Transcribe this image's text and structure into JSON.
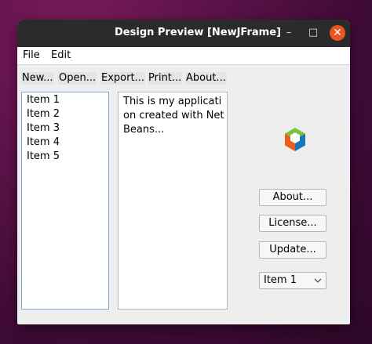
{
  "window": {
    "title": "Design Preview [NewJFrame]",
    "controls": {
      "minimize": "–",
      "maximize": "□",
      "close": "✕"
    }
  },
  "menubar": {
    "items": [
      "File",
      "Edit"
    ]
  },
  "toolbar": {
    "buttons": [
      "New...",
      "Open...",
      "Export...",
      "Print...",
      "About..."
    ]
  },
  "list": {
    "items": [
      "Item 1",
      "Item 2",
      "Item 3",
      "Item 4",
      "Item 5"
    ]
  },
  "textarea": {
    "text": "This is my application created with NetBeans..."
  },
  "logo": {
    "icon": "netbeans-logo-icon"
  },
  "side_buttons": {
    "about": "About...",
    "license": "License...",
    "update": "Update..."
  },
  "combo": {
    "selected": "Item 1"
  },
  "colors": {
    "close_button": "#e95420",
    "titlebar": "#2b2b2b",
    "list_border": "#7fa8d8"
  }
}
